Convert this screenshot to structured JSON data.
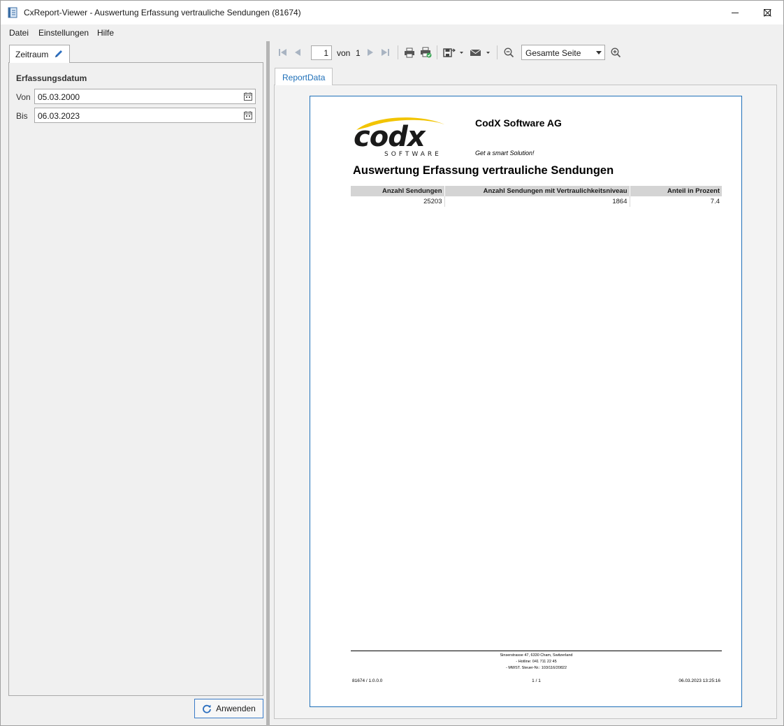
{
  "window": {
    "title": "CxReport-Viewer - Auswertung Erfassung vertrauliche Sendungen (81674)"
  },
  "menu": {
    "items": [
      "Datei",
      "Einstellungen",
      "Hilfe"
    ]
  },
  "left_panel": {
    "tab_label": "Zeitraum",
    "section_label": "Erfassungsdatum",
    "from_label": "Von",
    "from_value": "05.03.2000",
    "to_label": "Bis",
    "to_value": "06.03.2023",
    "apply_label": "Anwenden"
  },
  "toolbar": {
    "page_current": "1",
    "page_of_label": "von",
    "page_total": "1",
    "zoom_value": "Gesamte Seite"
  },
  "report_tab": {
    "label": "ReportData"
  },
  "report": {
    "company": "CodX Software AG",
    "slogan": "Get a smart Solution!",
    "logo_text": "codx",
    "logo_sub": "SOFTWARE",
    "title": "Auswertung Erfassung vertrauliche Sendungen",
    "table": {
      "headers": [
        "Anzahl Sendungen",
        "Anzahl Sendungen mit Vertraulichkeitsniveau",
        "Anteil in Prozent"
      ],
      "rows": [
        [
          "25203",
          "1864",
          "7.4"
        ]
      ]
    },
    "footer": {
      "address_line1": "Sinserstrasse 47, 6330 Cham, Switzerland",
      "address_line2": "- Hotline: 041 711 22 45",
      "address_line3": "- MWST. Steuer-Nr.: 103/116/20822",
      "left": "81674 / 1.0.0.0",
      "center": "1 / 1",
      "right": "06.03.2023 13:25:16"
    }
  },
  "colors": {
    "accent": "#1e6fb8",
    "logo_yellow": "#f2c400"
  }
}
